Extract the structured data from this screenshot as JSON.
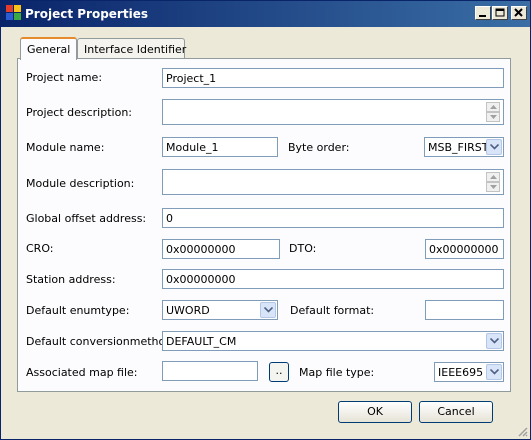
{
  "window": {
    "title": "Project Properties"
  },
  "tabs": [
    {
      "label": "General",
      "active": true
    },
    {
      "label": "Interface Identifier",
      "active": false
    }
  ],
  "form": {
    "project_name": {
      "label": "Project name:",
      "value": "Project_1"
    },
    "project_description": {
      "label": "Project description:",
      "value": ""
    },
    "module_name": {
      "label": "Module name:",
      "value": "Module_1"
    },
    "byte_order": {
      "label": "Byte order:",
      "value": "MSB_FIRST"
    },
    "module_description": {
      "label": "Module description:",
      "value": ""
    },
    "global_offset_address": {
      "label": "Global offset address:",
      "value": "0"
    },
    "cro": {
      "label": "CRO:",
      "value": "0x00000000"
    },
    "dto": {
      "label": "DTO:",
      "value": "0x00000000"
    },
    "station_address": {
      "label": "Station address:",
      "value": "0x00000000"
    },
    "default_enumtype": {
      "label": "Default enumtype:",
      "value": "UWORD"
    },
    "default_format": {
      "label": "Default format:",
      "value": ""
    },
    "default_conversionmethod": {
      "label": "Default conversionmethod:",
      "value": "DEFAULT_CM"
    },
    "associated_map_file": {
      "label": "Associated map file:",
      "value": "",
      "browse_label": ".."
    },
    "map_file_type": {
      "label": "Map file type:",
      "value": "IEEE695"
    }
  },
  "buttons": {
    "ok": "OK",
    "cancel": "Cancel"
  },
  "icons": {
    "app": "project-icon",
    "minimize": "minimize-icon",
    "maximize": "maximize-icon",
    "close": "close-icon",
    "dropdown": "chevron-down-icon",
    "spin_up": "spin-up-icon",
    "spin_down": "spin-down-icon",
    "grip": "resize-grip-icon"
  },
  "colors": {
    "titlebar_start": "#0a246a",
    "titlebar_end": "#3a6ea5",
    "tab_accent": "#e68b2c",
    "window_bg": "#ece9d8"
  }
}
